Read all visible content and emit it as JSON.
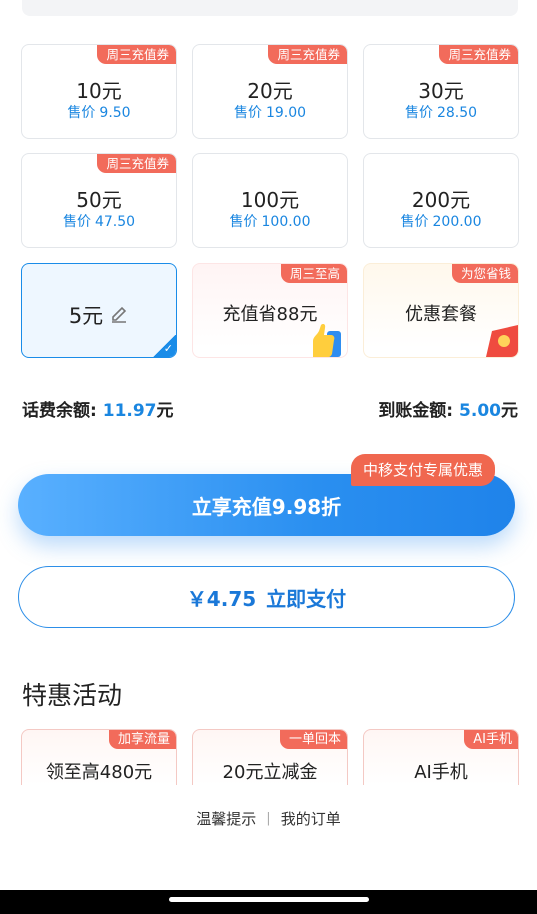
{
  "denominations": [
    {
      "amount": "10元",
      "price_prefix": "售价",
      "price": "9.50",
      "badge": "周三充值券"
    },
    {
      "amount": "20元",
      "price_prefix": "售价",
      "price": "19.00",
      "badge": "周三充值券"
    },
    {
      "amount": "30元",
      "price_prefix": "售价",
      "price": "28.50",
      "badge": "周三充值券"
    },
    {
      "amount": "50元",
      "price_prefix": "售价",
      "price": "47.50",
      "badge": "周三充值券"
    },
    {
      "amount": "100元",
      "price_prefix": "售价",
      "price": "100.00",
      "badge": ""
    },
    {
      "amount": "200元",
      "price_prefix": "售价",
      "price": "200.00",
      "badge": ""
    }
  ],
  "custom_amount": {
    "amount": "5元",
    "icon": "edit-icon",
    "selected": true
  },
  "promos": [
    {
      "label": "充值省88元",
      "badge": "周三至高"
    },
    {
      "label": "优惠套餐",
      "badge": "为您省钱"
    }
  ],
  "balance": {
    "label": "话费余额:",
    "value": "11.97",
    "unit": "元"
  },
  "arrival": {
    "label": "到账金额:",
    "value": "5.00",
    "unit": "元"
  },
  "primary_button": {
    "label": "立享充值9.98折",
    "tag": "中移支付专属优惠"
  },
  "pay_button": {
    "amount": "￥4.75",
    "label": "立即支付"
  },
  "section_title": "特惠活动",
  "activities": [
    {
      "label": "领至高480元",
      "badge": "加享流量"
    },
    {
      "label": "20元立减金",
      "badge": "一单回本"
    },
    {
      "label": "AI手机",
      "badge": "AI手机"
    }
  ],
  "footer": {
    "tips": "温馨提示",
    "separator": "|",
    "orders": "我的订单"
  },
  "colors": {
    "accent_blue": "#1a86e0",
    "badge_red": "#f26b5b",
    "promo_orange": "#f0674f"
  }
}
